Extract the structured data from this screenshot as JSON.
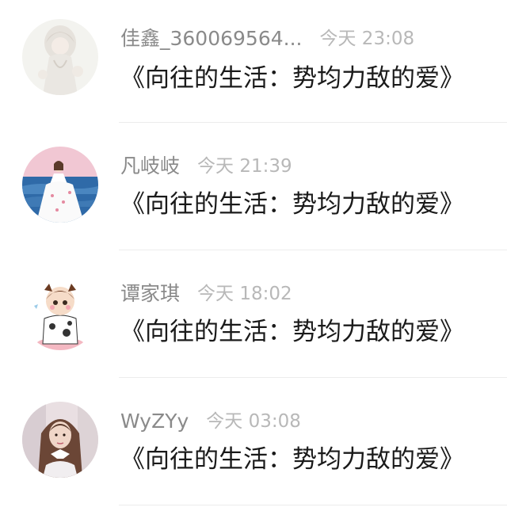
{
  "comments": [
    {
      "name": "佳鑫_360069564...",
      "time": "今天 23:08",
      "text": "《向往的生活：势均力敌的爱》",
      "avatar": "avatar-illustrated-girl-white"
    },
    {
      "name": "凡岐岐",
      "time": "今天 21:39",
      "text": "《向往的生活：势均力敌的爱》",
      "avatar": "avatar-girl-by-sea"
    },
    {
      "name": "谭家琪",
      "time": "今天 18:02",
      "text": "《向往的生活：势均力敌的爱》",
      "avatar": "avatar-cartoon-boy-cow"
    },
    {
      "name": "WyZYy",
      "time": "今天 03:08",
      "text": "《向往的生活：势均力敌的爱》",
      "avatar": "avatar-photo-girl"
    }
  ]
}
